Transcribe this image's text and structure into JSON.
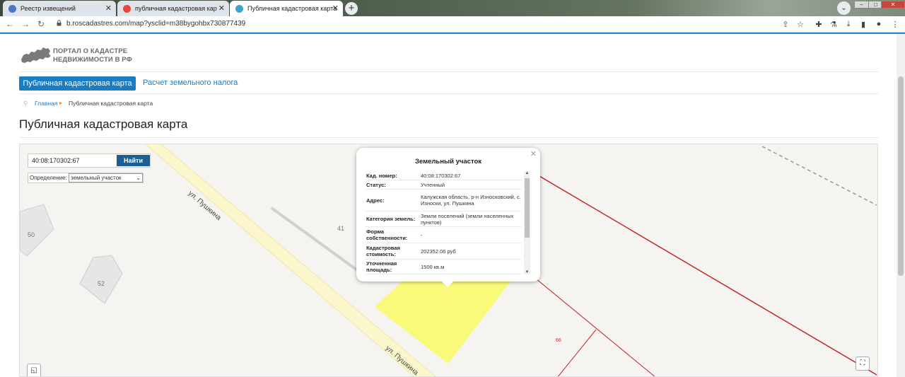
{
  "browser": {
    "tabs": [
      {
        "label": "Реестр извещений"
      },
      {
        "label": "публичная кадастровая карта –"
      },
      {
        "label": "Публичная кадастровая карта"
      }
    ],
    "url": "b.roscadastres.com/map?ysclid=m38bygohbx730877439"
  },
  "site": {
    "logo_line1": "ПОРТАЛ О КАДАСТРЕ",
    "logo_line2": "НЕДВИЖИМОСТИ В РФ",
    "nav": {
      "active": "Публичная кадастровая карта",
      "link": "Расчет земельного налога"
    },
    "breadcrumb": {
      "home": "Главная",
      "current": "Публичная кадастровая карта"
    },
    "page_title": "Публичная кадастровая карта"
  },
  "map": {
    "search_value": "40:08:170302:67",
    "search_button": "Найти",
    "definition_label": "Определение:",
    "definition_value": "земельный участок",
    "labels": {
      "street1": "ул. Пушкина",
      "street2": "ул. Пушкина",
      "house50": "50",
      "house52": "52",
      "lot41": "41",
      "lot66": "66"
    },
    "colors": {
      "parcel_fill": "#fafa7a",
      "boundary": "#c0282d",
      "road": "#fbf6cc"
    }
  },
  "popup": {
    "title": "Земельный участок",
    "rows": [
      {
        "key": "Кад. номер:",
        "value": "40:08:170302:67"
      },
      {
        "key": "Статус:",
        "value": "Учтенный"
      },
      {
        "key": "Адрес:",
        "value": "Калужская область, р-н Износковский, с. Износки, ул. Пушкина"
      },
      {
        "key": "Категория земель:",
        "value": "Земли поселений (земли населенных пунктов)"
      },
      {
        "key": "Форма собственности:",
        "value": "-"
      },
      {
        "key": "Кадастровая стоимость:",
        "value": "202352.06 руб"
      },
      {
        "key": "Уточненная площадь:",
        "value": "1500 кв.м"
      }
    ]
  }
}
